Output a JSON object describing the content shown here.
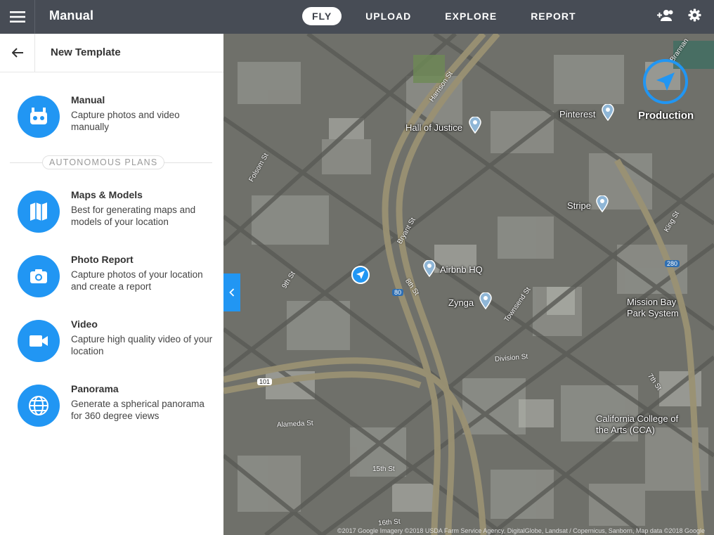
{
  "app": {
    "title": "Manual"
  },
  "nav": {
    "tabs": [
      {
        "label": "FLY",
        "active": true
      },
      {
        "label": "UPLOAD",
        "active": false
      },
      {
        "label": "EXPLORE",
        "active": false
      },
      {
        "label": "REPORT",
        "active": false
      }
    ]
  },
  "top_icons": [
    "menu-icon",
    "add-user-icon",
    "gear-icon"
  ],
  "sidebar": {
    "title": "New Template",
    "manual": {
      "title": "Manual",
      "desc": "Capture photos and video manually",
      "icon": "drone-icon"
    },
    "section_label": "AUTONOMOUS PLANS",
    "plans": [
      {
        "title": "Maps & Models",
        "desc": "Best for generating maps and models of your location",
        "icon": "map-icon"
      },
      {
        "title": "Photo Report",
        "desc": "Capture photos of your location and create a report",
        "icon": "camera-icon"
      },
      {
        "title": "Video",
        "desc": "Capture high quality video of your location",
        "icon": "video-icon"
      },
      {
        "title": "Panorama",
        "desc": "Generate a spherical panorama for 360 degree views",
        "icon": "globe-icon"
      }
    ]
  },
  "map": {
    "production_label": "Production",
    "places": [
      "Hall of Justice",
      "Pinterest",
      "Stripe",
      "Airbnb HQ",
      "Zynga",
      "Mission Bay Park System",
      "California College of the Arts (CCA)"
    ],
    "streets": [
      "Harrison St",
      "Bryant St",
      "8th St",
      "9th St",
      "Folsom St",
      "Townsend St",
      "King St",
      "Division St",
      "Alameda St",
      "15th St",
      "16th St",
      "7th St",
      "Brannan"
    ],
    "highways": [
      "80",
      "101",
      "280"
    ],
    "attribution": "©2017 Google Imagery ©2018 USDA Farm Service Agency, DigitalGlobe, Landsat / Copernicus, Sanborn, Map data ©2018 Google"
  },
  "colors": {
    "accent": "#2196f3",
    "topbar": "#474c55"
  }
}
